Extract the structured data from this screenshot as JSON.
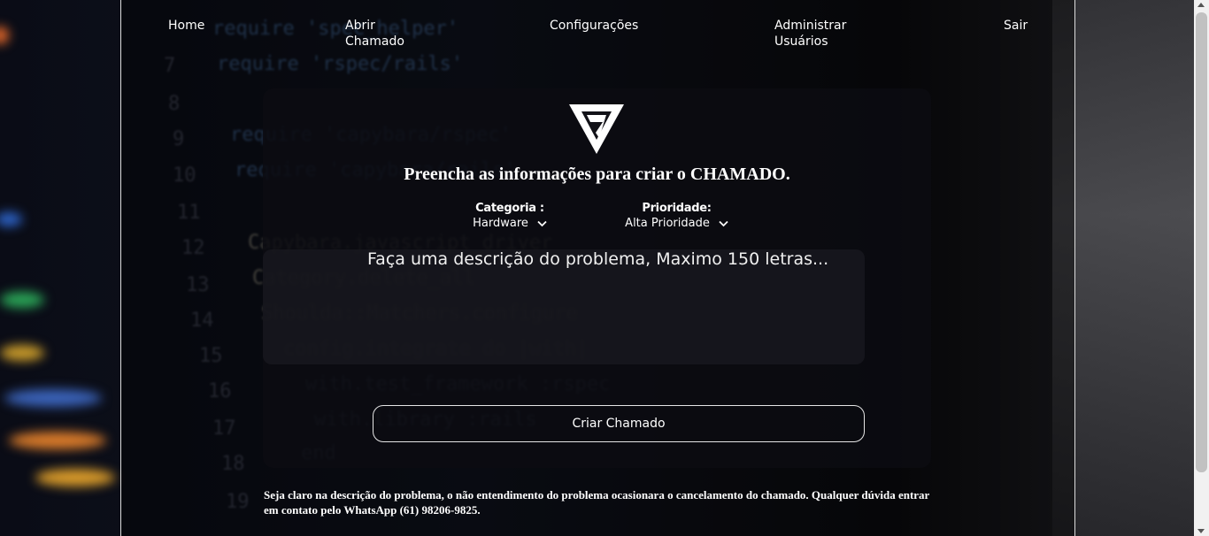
{
  "nav": {
    "home": "Home",
    "abrir_chamado": "Abrir Chamado",
    "configuracoes": "Configurações",
    "administrar_usuarios": "Administrar Usuários",
    "sair": "Sair"
  },
  "form": {
    "title": "Preencha as informações para criar o CHAMADO.",
    "categoria_label": "Categoria :",
    "categoria_value": "Hardware",
    "prioridade_label": "Prioridade:",
    "prioridade_value": "Alta Prioridade",
    "description_placeholder": "Faça uma descrição do problema, Maximo 150 letras...",
    "submit_label": "Criar Chamado"
  },
  "note": "Seja claro na descrição do problema, o não entendimento do problema ocasionara o cancelamento do chamado. Qualquer dúvida entrar em contato pelo WhatsApp (61) 98206-9825.",
  "icons": {
    "logo": "triangle-logo-icon",
    "select_arrow": "chevron-down-icon"
  }
}
